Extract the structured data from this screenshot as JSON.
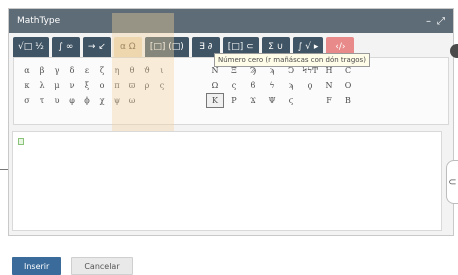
{
  "window": {
    "title": "MathType",
    "minimize_glyph": "–",
    "resize_glyph": "⤢"
  },
  "tabs": [
    {
      "label": "√□ ½",
      "icon": "radical-icon"
    },
    {
      "label": "∫ ∞",
      "icon": "integral-icon"
    },
    {
      "label": "→ ↙",
      "icon": "arrows-icon"
    },
    {
      "label": "α Ω",
      "icon": "greek-icon",
      "active": true
    },
    {
      "label": "[□] (□)",
      "icon": "brackets-icon"
    },
    {
      "label": "∃ ∂",
      "icon": "logic-icon"
    },
    {
      "label": "[□] ⊂",
      "icon": "matrix-icon"
    },
    {
      "label": "Σ ∪",
      "icon": "sum-icon"
    },
    {
      "label": "∫ √ ▸",
      "icon": "calc-icon"
    },
    {
      "label": "‹/›",
      "icon": "chem-icon"
    }
  ],
  "palette": {
    "greek_lower": [
      "α",
      "β",
      "γ",
      "δ",
      "ε",
      "ζ",
      "η",
      "θ",
      "ϑ",
      "ι",
      "",
      "",
      "κ",
      "λ",
      "μ",
      "ν",
      "ξ",
      "ο",
      "π",
      "ϖ",
      "ρ",
      "ς",
      "",
      "",
      "σ",
      "τ",
      "υ",
      "φ",
      "ϕ",
      "χ",
      "ψ",
      "ω",
      "",
      "",
      "",
      ""
    ],
    "greek_upper": [
      "N",
      "Ξ",
      "Ϡ",
      "ϡ",
      "Ͻ",
      "ϞϟͲ",
      "H",
      "C",
      "",
      "Ω",
      "ς",
      "ϐ",
      "ϟ",
      "ϡ",
      "ϙ",
      "N",
      "O",
      "",
      "Κ",
      "Ρ",
      "Ϫ",
      "Ψ",
      "ϛ",
      "",
      "F",
      "B",
      ""
    ],
    "selected_symbol": "Κ",
    "tooltip": "Número cero (r mañáscas con dón tragos)"
  },
  "editor": {
    "content": ""
  },
  "buttons": {
    "insert": "Inserir",
    "cancel": "Cancelar"
  },
  "side": {
    "handle_glyph": "⊂"
  }
}
